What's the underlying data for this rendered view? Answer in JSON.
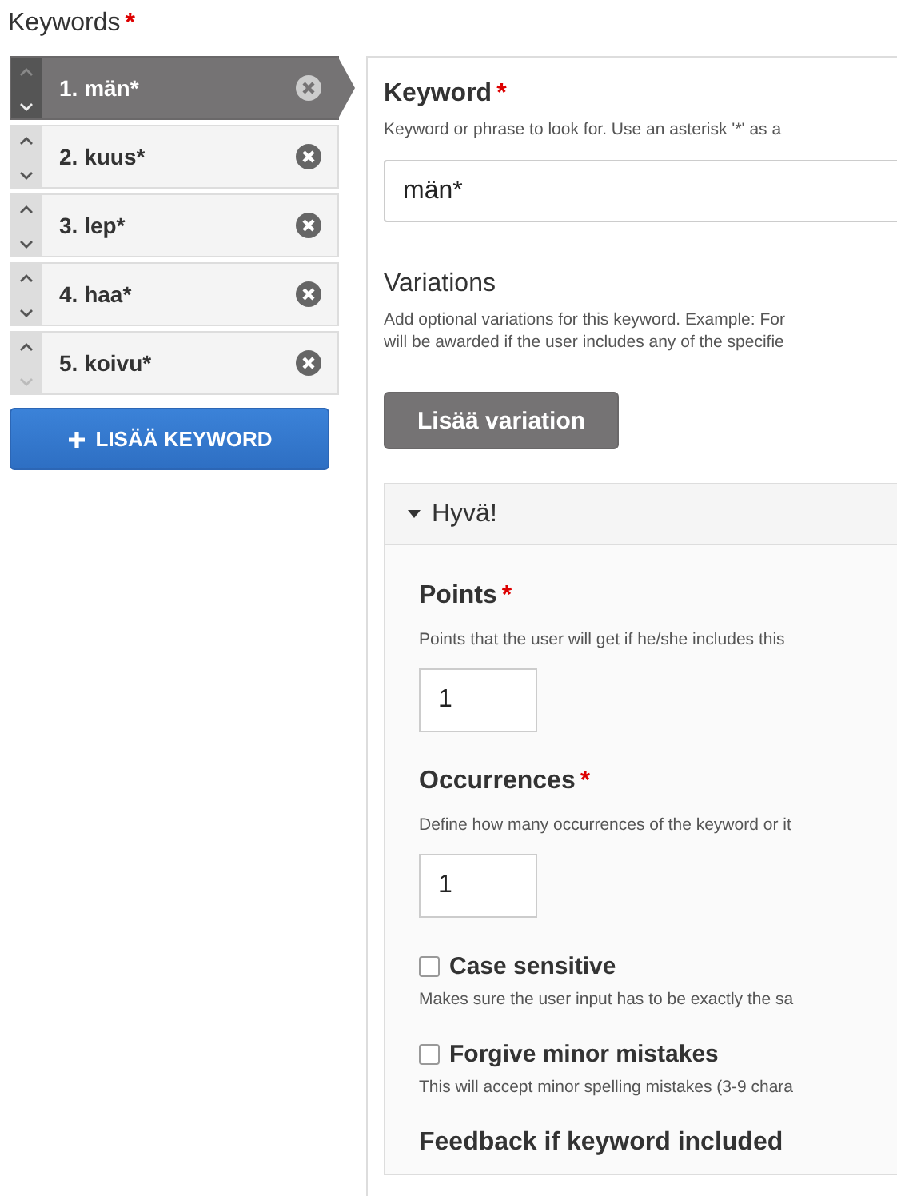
{
  "title": {
    "text": "Keywords",
    "required_mark": "*"
  },
  "keywords": [
    {
      "label": "1. män*",
      "selected": true,
      "can_move_up": false,
      "can_move_down": true
    },
    {
      "label": "2. kuus*",
      "selected": false,
      "can_move_up": true,
      "can_move_down": true
    },
    {
      "label": "3. lep*",
      "selected": false,
      "can_move_up": true,
      "can_move_down": true
    },
    {
      "label": "4. haa*",
      "selected": false,
      "can_move_up": true,
      "can_move_down": true
    },
    {
      "label": "5. koivu*",
      "selected": false,
      "can_move_up": true,
      "can_move_down": false
    }
  ],
  "add_keyword_button": "LISÄÄ KEYWORD",
  "keyword_field": {
    "label": "Keyword",
    "required_mark": "*",
    "hint": "Keyword or phrase to look for. Use an asterisk '*' as a",
    "value": "män*"
  },
  "variations": {
    "label": "Variations",
    "hint_lines": [
      "Add optional variations for this keyword. Example: For",
      "will be awarded if the user includes any of the specifie"
    ],
    "button": "Lisää variation"
  },
  "variation": {
    "title": "Hyvä!",
    "expanded": true,
    "fields": [
      {
        "kind": "number",
        "label": "Points",
        "required_mark": "*",
        "hint": "Points that the user will get if he/she includes this",
        "value": "1"
      },
      {
        "kind": "number",
        "label": "Occurrences",
        "required_mark": "*",
        "hint": "Define how many occurrences of the keyword or it",
        "value": "1"
      },
      {
        "kind": "checkbox",
        "label": "Case sensitive",
        "checked": false,
        "hint": "Makes sure the user input has to be exactly the sa"
      },
      {
        "kind": "checkbox",
        "label": "Forgive minor mistakes",
        "checked": false,
        "hint": "This will accept minor spelling mistakes (3-9 chara"
      },
      {
        "kind": "heading",
        "label": "Feedback if keyword included"
      }
    ]
  }
}
